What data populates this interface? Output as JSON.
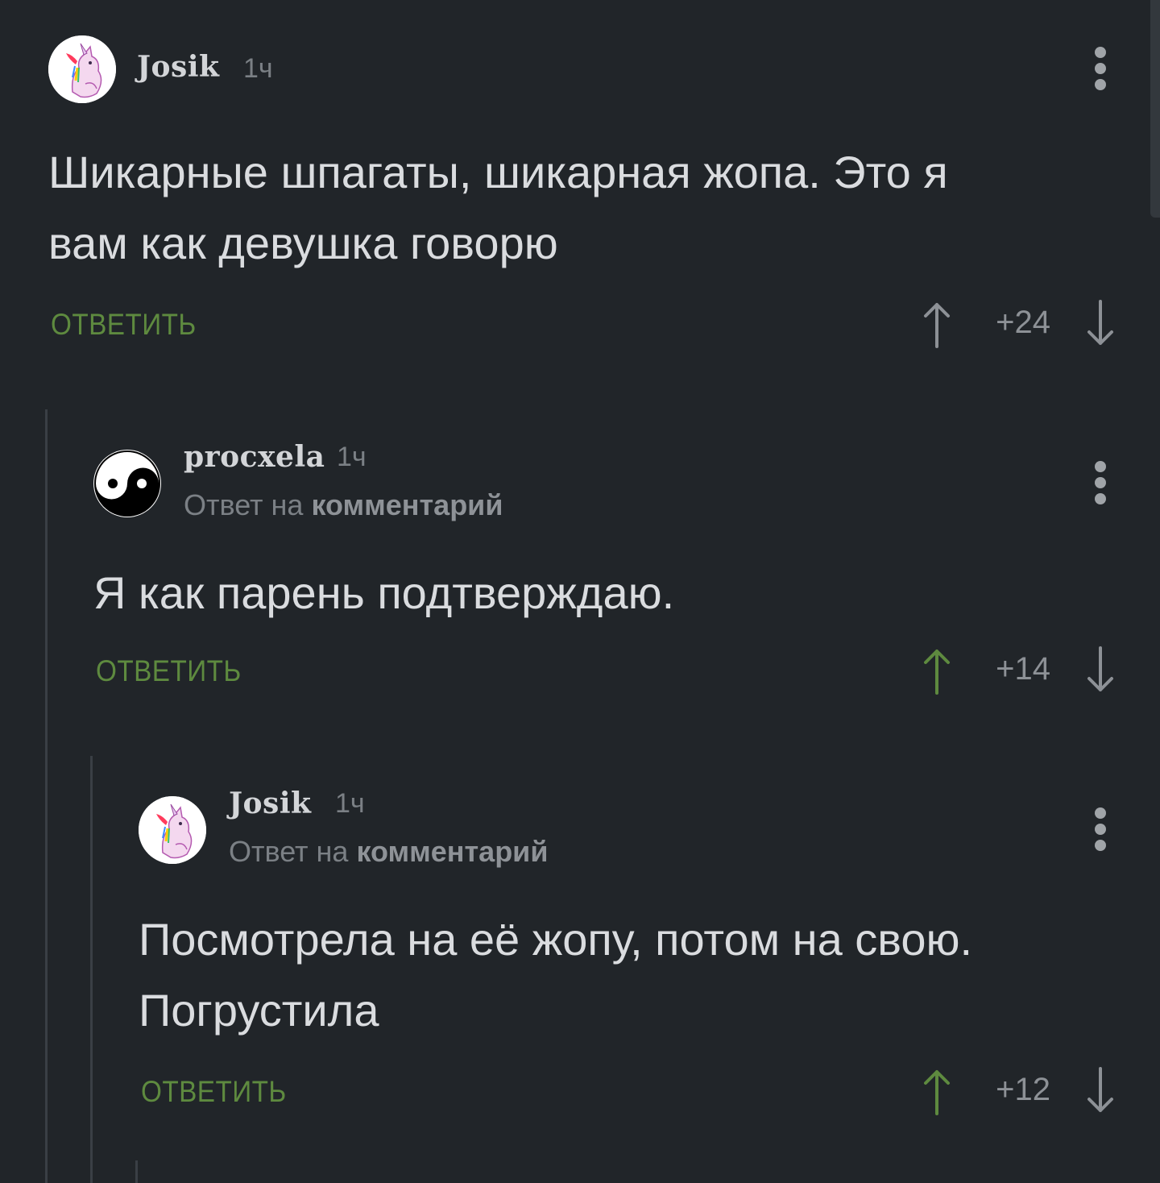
{
  "colors": {
    "background": "#212529",
    "reply_green": "#5e8a3f",
    "upvoted_green": "#5e8a3f",
    "neutral_arrow": "#8d9196"
  },
  "comments": [
    {
      "username": "Josik",
      "time": "1ч",
      "reply_prefix": "",
      "reply_link": "",
      "text": "Шикарные шпагаты, шикарная жопа. Это я\nвам как девушка говорю",
      "reply_label": "ОТВЕТИТЬ",
      "rating": "+24",
      "upvoted": false,
      "avatar": "unicorn-avatar"
    },
    {
      "username": "procxela",
      "time": "1ч",
      "reply_prefix": "Ответ на",
      "reply_link": "комментарий",
      "text": "Я как парень подтверждаю.",
      "reply_label": "ОТВЕТИТЬ",
      "rating": "+14",
      "upvoted": true,
      "avatar": "yin-yang-avatar"
    },
    {
      "username": "Josik",
      "time": "1ч",
      "reply_prefix": "Ответ на",
      "reply_link": "комментарий",
      "text": "Посмотрела на её жопу, потом на свою.\nПогрустила",
      "reply_label": "ОТВЕТИТЬ",
      "rating": "+12",
      "upvoted": true,
      "avatar": "unicorn-avatar"
    }
  ]
}
